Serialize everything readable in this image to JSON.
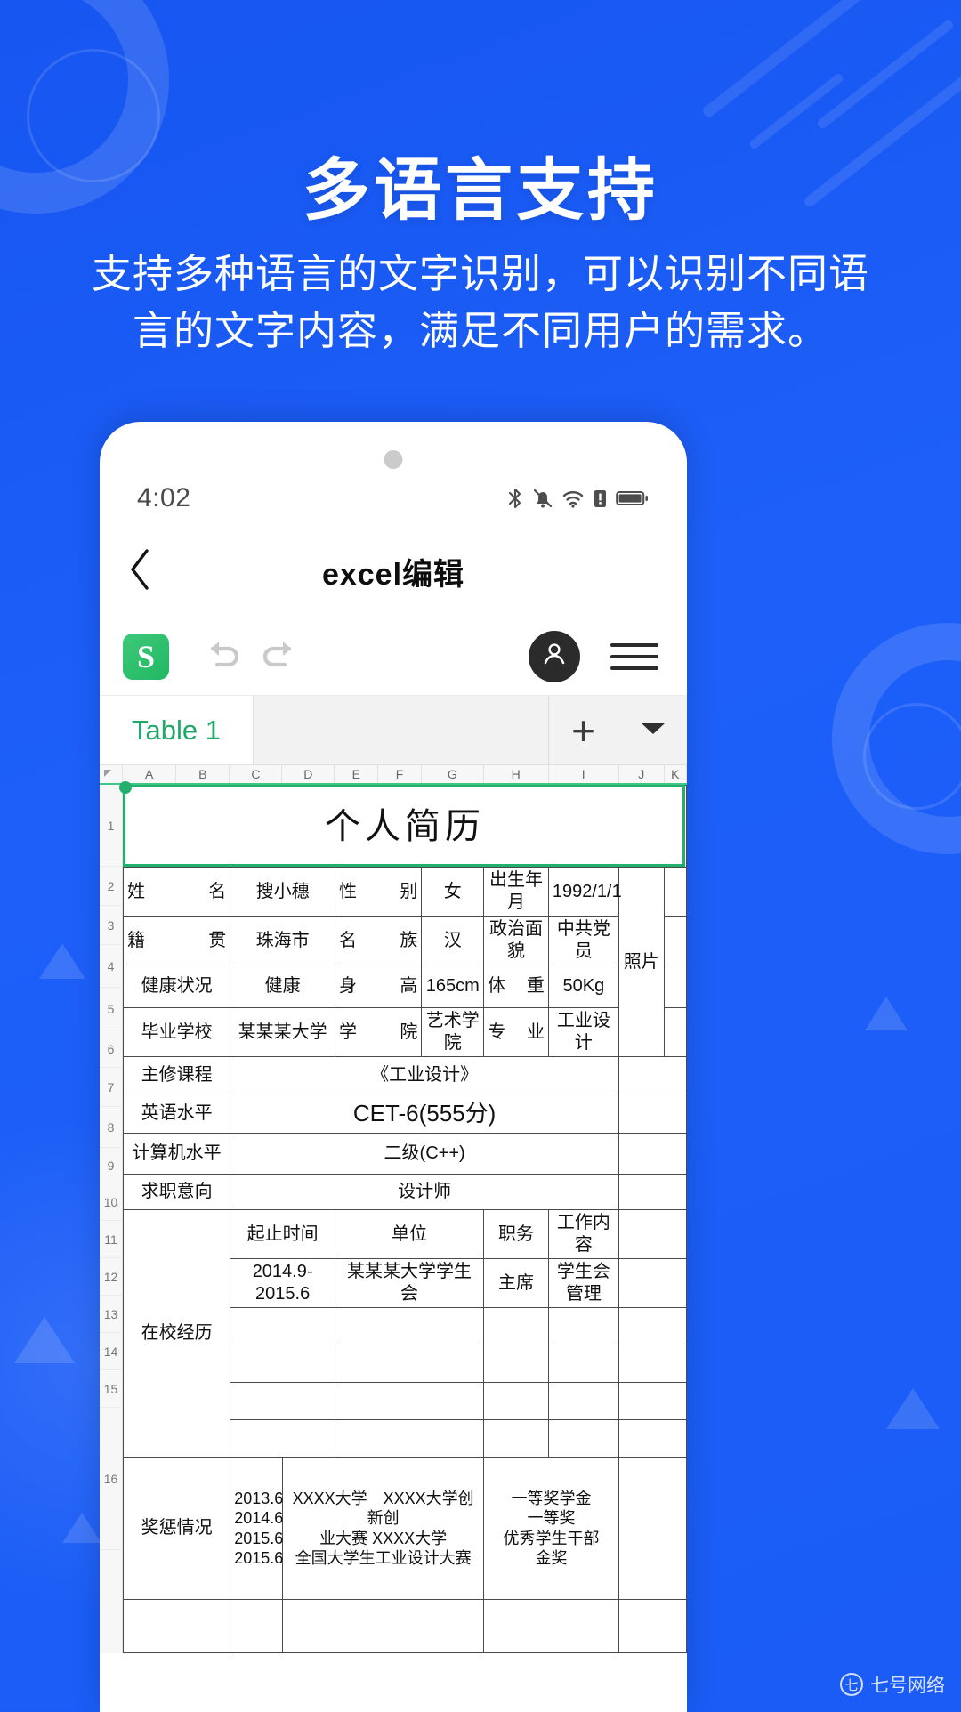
{
  "promo": {
    "headline": "多语言支持",
    "subhead": "支持多种语言的文字识别，可以识别不同语言的文字内容，满足不同用户的需求。",
    "bg_color": "#1a5cf5"
  },
  "watermark": {
    "badge": "七",
    "text": "七号网络"
  },
  "phone": {
    "statusbar": {
      "time": "4:02",
      "icons": [
        "bluetooth-icon",
        "bell-muted-icon",
        "wifi-icon",
        "alert-battery-icon",
        "battery-icon"
      ]
    },
    "navbar": {
      "back_icon": "chevron-left-icon",
      "title": "excel编辑"
    },
    "toolbar": {
      "logo_letter": "S",
      "undo_icon": "undo-icon",
      "redo_icon": "redo-icon",
      "avatar_icon": "user-icon",
      "menu_icon": "hamburger-icon"
    },
    "sheetbar": {
      "tab_label": "Table 1",
      "add_label": "+",
      "dropdown_label": "▼"
    },
    "grid": {
      "columns": [
        "A",
        "B",
        "C",
        "D",
        "E",
        "F",
        "G",
        "H",
        "I",
        "J",
        "K"
      ],
      "row_numbers": [
        "1",
        "2",
        "3",
        "4",
        "5",
        "6",
        "7",
        "8",
        "9",
        "10",
        "11",
        "12",
        "13",
        "14",
        "15",
        "16"
      ],
      "accent_color": "#22b06c"
    }
  },
  "resume": {
    "title": "个人简历",
    "row2": {
      "label": "姓名",
      "name": "搜小穗",
      "sex_label": "性别",
      "sex": "女",
      "birth_label": "出生年月",
      "birth": "1992/1/1"
    },
    "row3": {
      "label": "籍贯",
      "hometown": "珠海市",
      "nation_label": "名族",
      "nation": "汉",
      "politics_label": "政治面貌",
      "politics": "中共党员",
      "photo": "照片"
    },
    "row4": {
      "label": "健康状况",
      "health": "健康",
      "height_label": "身高",
      "height": "165cm",
      "weight_label": "体重",
      "weight": "50Kg"
    },
    "row5": {
      "label": "毕业学校",
      "school": "某某某大学",
      "college_label": "学院",
      "college": "艺术学院",
      "major_label": "专业",
      "major": "工业设计"
    },
    "row6": {
      "label": "主修课程",
      "value": "《工业设计》"
    },
    "row7": {
      "label": "英语水平",
      "value": "CET-6(555分)"
    },
    "row8": {
      "label": "计算机水平",
      "value": "二级(C++)"
    },
    "row9": {
      "label": "求职意向",
      "value": "设计师"
    },
    "experience": {
      "label": "在校经历",
      "headers": [
        "起止时间",
        "单位",
        "职务",
        "工作内容"
      ],
      "rows": [
        [
          "2014.9-2015.6",
          "某某某大学学生会",
          "主席",
          "学生会管理"
        ],
        [
          "",
          "",
          "",
          ""
        ],
        [
          "",
          "",
          "",
          ""
        ],
        [
          "",
          "",
          "",
          ""
        ],
        [
          "",
          "",
          "",
          ""
        ]
      ]
    },
    "awards": {
      "label": "奖惩情况",
      "dates": "2013.6\n2014.6\n2015.6\n2015.6",
      "events": "XXXX大学　XXXX大学创新创\n业大赛 XXXX大学\n全国大学生工业设计大赛",
      "results": "一等奖学金\n一等奖\n优秀学生干部\n金奖"
    }
  }
}
